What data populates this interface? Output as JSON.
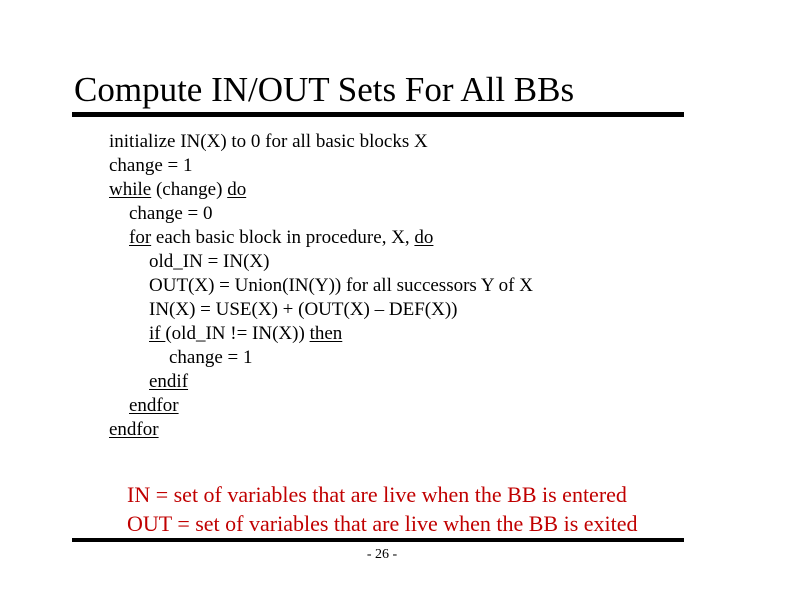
{
  "slide": {
    "title": "Compute IN/OUT Sets For All BBs",
    "page_number": "- 26 -"
  },
  "colors": {
    "text": "#000000",
    "definition_text": "#c00000",
    "rule": "#000000",
    "background": "#ffffff"
  },
  "code": {
    "lines": [
      {
        "indent": 0,
        "parts": [
          {
            "text": "initialize IN(X) to 0 for all basic blocks X",
            "keyword": false
          }
        ]
      },
      {
        "indent": 0,
        "parts": [
          {
            "text": "change = 1",
            "keyword": false
          }
        ]
      },
      {
        "indent": 0,
        "parts": [
          {
            "text": "while",
            "keyword": true
          },
          {
            "text": " (change) ",
            "keyword": false
          },
          {
            "text": "do",
            "keyword": true
          }
        ]
      },
      {
        "indent": 1,
        "parts": [
          {
            "text": "change = 0",
            "keyword": false
          }
        ]
      },
      {
        "indent": 1,
        "parts": [
          {
            "text": "for",
            "keyword": true
          },
          {
            "text": " each basic block in procedure, X, ",
            "keyword": false
          },
          {
            "text": "do",
            "keyword": true
          }
        ]
      },
      {
        "indent": 2,
        "parts": [
          {
            "text": "old_IN = IN(X)",
            "keyword": false
          }
        ]
      },
      {
        "indent": 2,
        "parts": [
          {
            "text": "OUT(X) = Union(IN(Y)) for all successors Y of X",
            "keyword": false
          }
        ]
      },
      {
        "indent": 2,
        "parts": [
          {
            "text": "IN(X) = USE(X) + (OUT(X) – DEF(X))",
            "keyword": false
          }
        ]
      },
      {
        "indent": 2,
        "parts": [
          {
            "text": "if ",
            "keyword": true
          },
          {
            "text": "(old_IN != IN(X)) ",
            "keyword": false
          },
          {
            "text": "then",
            "keyword": true
          }
        ]
      },
      {
        "indent": 3,
        "parts": [
          {
            "text": "change = 1",
            "keyword": false
          }
        ]
      },
      {
        "indent": 2,
        "parts": [
          {
            "text": "endif",
            "keyword": true
          }
        ]
      },
      {
        "indent": 1,
        "parts": [
          {
            "text": "endfor",
            "keyword": true
          }
        ]
      },
      {
        "indent": 0,
        "parts": [
          {
            "text": "endfor",
            "keyword": true
          }
        ]
      }
    ]
  },
  "definitions": [
    "IN = set of variables that are live when the BB is entered",
    "OUT = set of variables that are live when the BB is exited"
  ]
}
